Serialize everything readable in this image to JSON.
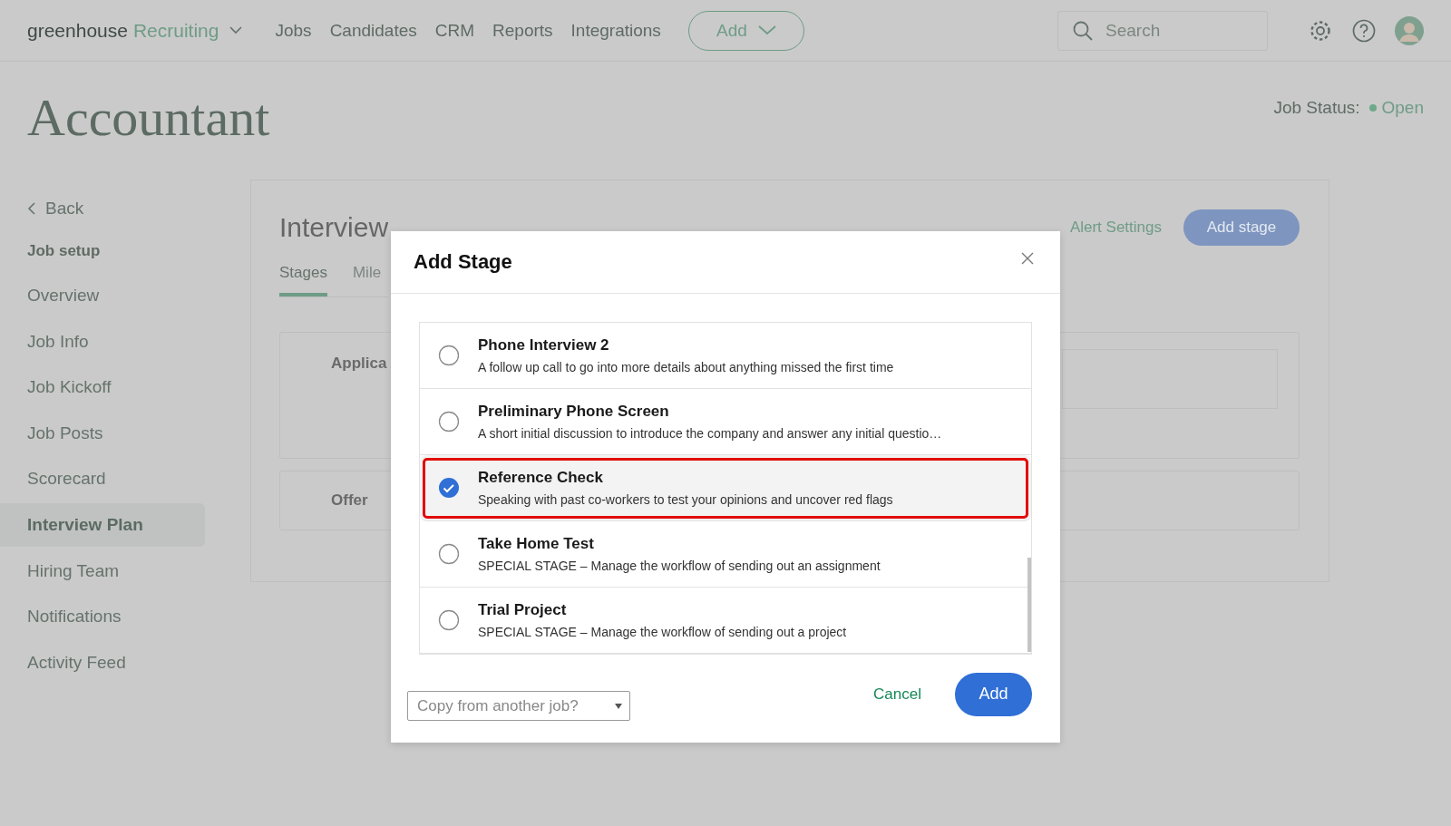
{
  "nav": {
    "logo_word": "greenhouse",
    "logo_product": "Recruiting",
    "items": [
      {
        "label": "Jobs"
      },
      {
        "label": "Candidates"
      },
      {
        "label": "CRM"
      },
      {
        "label": "Reports"
      },
      {
        "label": "Integrations"
      }
    ],
    "add_button": "Add",
    "search": {
      "placeholder": "Search"
    }
  },
  "page": {
    "title": "Accountant",
    "job_status_label": "Job Status:",
    "job_status_value": "Open"
  },
  "sidebar": {
    "back": "Back",
    "section": "Job setup",
    "items": [
      {
        "label": "Overview",
        "selected": false
      },
      {
        "label": "Job Info",
        "selected": false
      },
      {
        "label": "Job Kickoff",
        "selected": false
      },
      {
        "label": "Job Posts",
        "selected": false
      },
      {
        "label": "Scorecard",
        "selected": false
      },
      {
        "label": "Interview Plan",
        "selected": true
      },
      {
        "label": "Hiring Team",
        "selected": false
      },
      {
        "label": "Notifications",
        "selected": false
      },
      {
        "label": "Activity Feed",
        "selected": false
      }
    ]
  },
  "interview_plan": {
    "heading": "Interview",
    "alert_settings": "Alert Settings",
    "add_stage": "Add stage",
    "tabs": [
      {
        "label": "Stages",
        "selected": true
      },
      {
        "label": "Mile",
        "selected": false
      }
    ],
    "stages": [
      {
        "name": "Applica",
        "kind": "block"
      },
      {
        "name": "Offer",
        "kind": "row"
      }
    ]
  },
  "modal": {
    "title": "Add Stage",
    "options": [
      {
        "name": "Phone Interview 2",
        "description": "A follow up call to go into more details about anything missed the first time",
        "selected": false
      },
      {
        "name": "Preliminary Phone Screen",
        "description": "A short initial discussion to introduce the company and answer any initial questio…",
        "selected": false
      },
      {
        "name": "Reference Check",
        "description": "Speaking with past co-workers to test your opinions and uncover red flags",
        "selected": true
      },
      {
        "name": "Take Home Test",
        "description": "SPECIAL STAGE – Manage the workflow of sending out an assignment",
        "selected": false
      },
      {
        "name": "Trial Project",
        "description": "SPECIAL STAGE – Manage the workflow of sending out a project",
        "selected": false
      }
    ],
    "copy_select": {
      "placeholder": "Copy from another job?"
    },
    "cancel": "Cancel",
    "add": "Add"
  }
}
